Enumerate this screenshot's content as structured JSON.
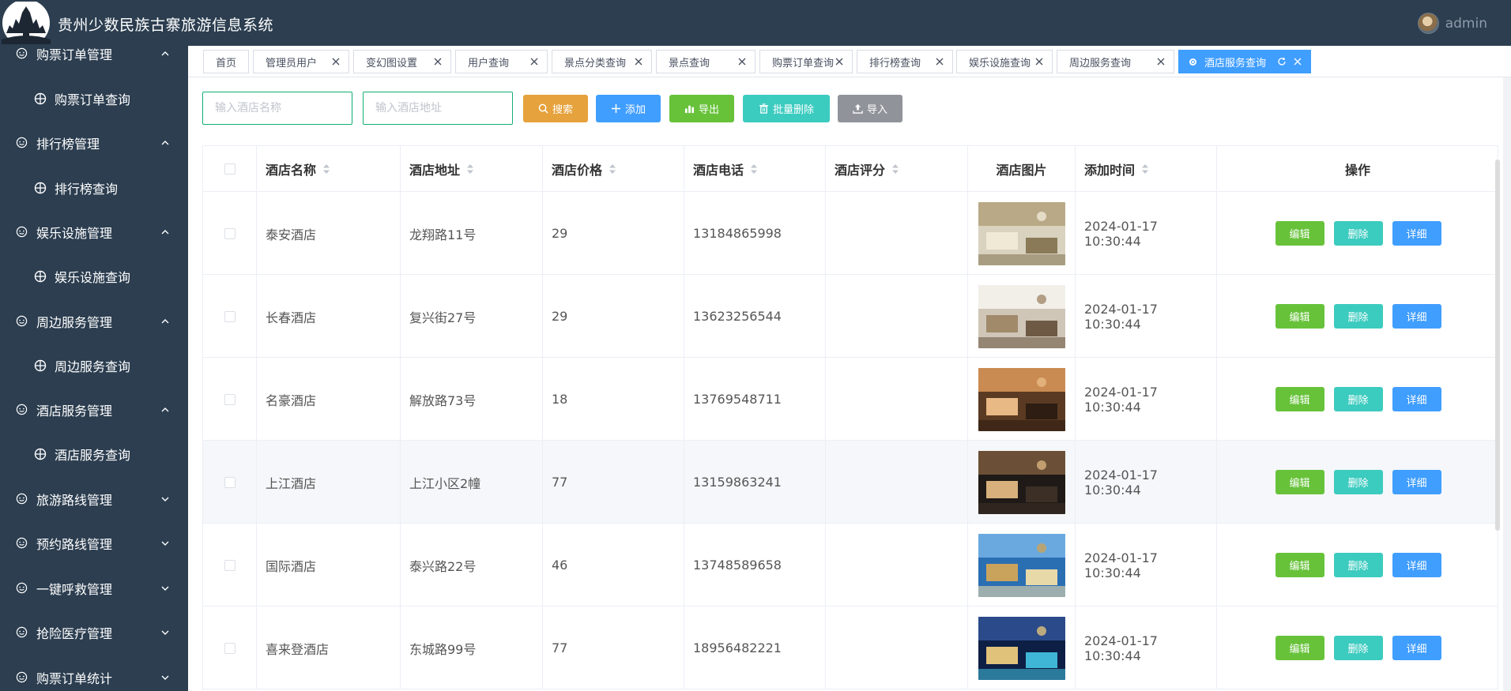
{
  "header": {
    "title": "贵州少数民族古寨旅游信息系统",
    "username": "admin"
  },
  "sidebar": {
    "items": [
      {
        "type": "group",
        "label": "购票订单管理",
        "expanded": true
      },
      {
        "type": "sub",
        "label": "购票订单查询"
      },
      {
        "type": "group",
        "label": "排行榜管理",
        "expanded": true
      },
      {
        "type": "sub",
        "label": "排行榜查询"
      },
      {
        "type": "group",
        "label": "娱乐设施管理",
        "expanded": true
      },
      {
        "type": "sub",
        "label": "娱乐设施查询"
      },
      {
        "type": "group",
        "label": "周边服务管理",
        "expanded": true
      },
      {
        "type": "sub",
        "label": "周边服务查询"
      },
      {
        "type": "group",
        "label": "酒店服务管理",
        "expanded": true
      },
      {
        "type": "sub",
        "label": "酒店服务查询"
      },
      {
        "type": "group",
        "label": "旅游路线管理",
        "expanded": false
      },
      {
        "type": "group",
        "label": "预约路线管理",
        "expanded": false
      },
      {
        "type": "group",
        "label": "一键呼救管理",
        "expanded": false
      },
      {
        "type": "group",
        "label": "抢险医疗管理",
        "expanded": false
      },
      {
        "type": "group",
        "label": "购票订单统计",
        "expanded": false
      }
    ]
  },
  "tabs": [
    {
      "label": "首页",
      "closable": false
    },
    {
      "label": "管理员用户",
      "closable": true
    },
    {
      "label": "变幻图设置",
      "closable": true
    },
    {
      "label": "用户查询",
      "closable": true
    },
    {
      "label": "景点分类查询",
      "closable": true
    },
    {
      "label": "景点查询",
      "closable": true
    },
    {
      "label": "购票订单查询",
      "closable": true
    },
    {
      "label": "排行榜查询",
      "closable": true
    },
    {
      "label": "娱乐设施查询",
      "closable": true
    },
    {
      "label": "周边服务查询",
      "closable": true
    },
    {
      "label": "酒店服务查询",
      "closable": true,
      "active": true
    }
  ],
  "search": {
    "name_placeholder": "输入酒店名称",
    "address_placeholder": "输入酒店地址",
    "search_label": "搜索",
    "add_label": "添加",
    "export_label": "导出",
    "batch_delete_label": "批量删除",
    "import_label": "导入"
  },
  "colors": {
    "search": "#e6a23c",
    "add": "#409eff",
    "export": "#67c23a",
    "batch_delete": "#3ccbbf",
    "import": "#909399",
    "edit": "#67c23a",
    "delete": "#3ccbbf",
    "detail": "#409eff"
  },
  "table": {
    "columns": [
      "酒店名称",
      "酒店地址",
      "酒店价格",
      "酒店电话",
      "酒店评分",
      "酒店图片",
      "添加时间",
      "操作"
    ],
    "action_labels": {
      "edit": "编辑",
      "delete": "删除",
      "detail": "详细"
    },
    "rows": [
      {
        "name": "泰安酒店",
        "address": "龙翔路11号",
        "price": "29",
        "phone": "13184865998",
        "rating": "",
        "time": "2024-01-17 10:30:44",
        "image": "hotel-lobby-image"
      },
      {
        "name": "长春酒店",
        "address": "复兴街27号",
        "price": "29",
        "phone": "13623256544",
        "rating": "",
        "time": "2024-01-17 10:30:44",
        "image": "hotel-room-image"
      },
      {
        "name": "名豪酒店",
        "address": "解放路73号",
        "price": "18",
        "phone": "13769548711",
        "rating": "",
        "time": "2024-01-17 10:30:44",
        "image": "hotel-suite-image"
      },
      {
        "name": "上江酒店",
        "address": "上江小区2幢",
        "price": "77",
        "phone": "13159863241",
        "rating": "",
        "time": "2024-01-17 10:30:44",
        "image": "hotel-lounge-image"
      },
      {
        "name": "国际酒店",
        "address": "泰兴路22号",
        "price": "46",
        "phone": "13748589658",
        "rating": "",
        "time": "2024-01-17 10:30:44",
        "image": "hotel-building-image"
      },
      {
        "name": "喜来登酒店",
        "address": "东城路99号",
        "price": "77",
        "phone": "18956482221",
        "rating": "",
        "time": "2024-01-17 10:30:44",
        "image": "hotel-pool-image"
      }
    ]
  }
}
